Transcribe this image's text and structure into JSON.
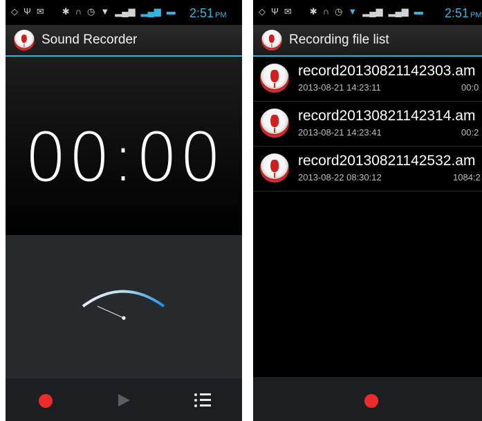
{
  "colors": {
    "accent": "#33b5e5",
    "record_red": "#ee2b2b"
  },
  "status_bar": {
    "time": "2:51",
    "ampm": "PM"
  },
  "recorder": {
    "title": "Sound Recorder",
    "timer": "00:00",
    "buttons": {
      "record": "record-icon",
      "play": "play-icon",
      "list": "list-icon"
    }
  },
  "file_list": {
    "title": "Recording file list",
    "items": [
      {
        "name": "record20130821142303.am",
        "date": "2013-08-21 14:23:11",
        "size": "00:0"
      },
      {
        "name": "record20130821142314.am",
        "date": "2013-08-21 14:23:41",
        "size": "00:2"
      },
      {
        "name": "record20130821142532.am",
        "date": "2013-08-22 08:30:12",
        "size": "1084:2"
      }
    ]
  }
}
